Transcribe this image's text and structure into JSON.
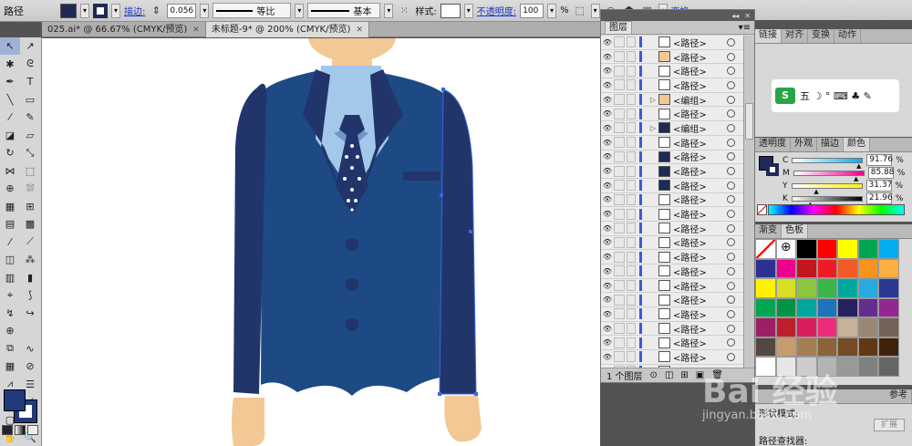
{
  "control_bar": {
    "object_type": "路径",
    "stroke_link": "描边:",
    "stroke_weight": "0.056",
    "profile_label": "等比",
    "brush_label": "基本",
    "style_label": "样式:",
    "opacity_link": "不透明度:",
    "opacity_value": "100",
    "opacity_unit": "%",
    "transform_link": "变换",
    "fill_color": "#1e2a55"
  },
  "doc_tabs": [
    {
      "label": "025.ai* @ 66.67% (CMYK/预览)"
    },
    {
      "label": "未标题-9* @ 200% (CMYK/预览)"
    }
  ],
  "layers_panel": {
    "title": "图层",
    "rows": [
      {
        "name": "<路径>",
        "thumb": "#ffffff"
      },
      {
        "name": "<路径>",
        "thumb": "#f2c894"
      },
      {
        "name": "<路径>",
        "thumb": "#ffffff"
      },
      {
        "name": "<路径>",
        "thumb": "#ffffff"
      },
      {
        "name": "<编组>",
        "thumb": "#f2c894"
      },
      {
        "name": "<路径>",
        "thumb": "#ffffff"
      },
      {
        "name": "<编组>",
        "thumb": "#1e2a55"
      },
      {
        "name": "<路径>",
        "thumb": "#ffffff"
      },
      {
        "name": "<路径>",
        "thumb": "#1e2a55"
      },
      {
        "name": "<路径>",
        "thumb": "#1e2a55"
      },
      {
        "name": "<路径>",
        "thumb": "#1e2a55"
      },
      {
        "name": "<路径>",
        "thumb": "#ffffff"
      },
      {
        "name": "<路径>",
        "thumb": "#ffffff"
      },
      {
        "name": "<路径>",
        "thumb": "#ffffff"
      },
      {
        "name": "<路径>",
        "thumb": "#ffffff"
      },
      {
        "name": "<路径>",
        "thumb": "#ffffff"
      },
      {
        "name": "<路径>",
        "thumb": "#ffffff"
      },
      {
        "name": "<路径>",
        "thumb": "#ffffff"
      },
      {
        "name": "<路径>",
        "thumb": "#ffffff"
      },
      {
        "name": "<路径>",
        "thumb": "#ffffff"
      },
      {
        "name": "<路径>",
        "thumb": "#ffffff"
      },
      {
        "name": "<路径>",
        "thumb": "#ffffff"
      },
      {
        "name": "<路径>",
        "thumb": "#ffffff"
      },
      {
        "name": "<路径>",
        "thumb": "#ffffff"
      }
    ],
    "footer_count": "1 个图层"
  },
  "right_panels": {
    "top_tabs": [
      "链接",
      "对齐",
      "变换",
      "动作"
    ],
    "ime_icons": "五 ☽ ° ⌨ ♣ ✎",
    "color_tabs": [
      "透明度",
      "外观",
      "描边",
      "颜色"
    ],
    "cmyk": [
      {
        "label": "C",
        "value": "91.76",
        "unit": "%",
        "pct": 91.76
      },
      {
        "label": "M",
        "value": "85.88",
        "unit": "%",
        "pct": 85.88
      },
      {
        "label": "Y",
        "value": "31.37",
        "unit": "%",
        "pct": 31.37
      },
      {
        "label": "K",
        "value": "21.96",
        "unit": "%",
        "pct": 21.96
      }
    ],
    "swatch_tabs": [
      "渐变",
      "色板"
    ],
    "swatches": [
      "#ffffff",
      "#ffffff",
      "#000000",
      "#ff0000",
      "#ffff00",
      "#00a651",
      "#00aeef",
      "#2e3192",
      "#ec008c",
      "#c4161c",
      "#ed1c24",
      "#f15a24",
      "#f7941d",
      "#fbb040",
      "#fff200",
      "#d7df23",
      "#8dc63f",
      "#39b54a",
      "#00a99d",
      "#27aae1",
      "#2b3990",
      "#00a651",
      "#009444",
      "#00a79d",
      "#1c75bc",
      "#262262",
      "#662d91",
      "#92278f",
      "#9e1f63",
      "#be1e2d",
      "#da1c5c",
      "#ed2a7b",
      "#c7b299",
      "#998675",
      "#736357",
      "#534741",
      "#c69c6d",
      "#a67c52",
      "#8c6239",
      "#754c24",
      "#603813",
      "#42210b",
      "#ffffff",
      "#e6e6e6",
      "#cccccc",
      "#b3b3b3",
      "#999999",
      "#808080",
      "#666666"
    ],
    "shape_mode_label": "形状模式:",
    "pathfinder_label": "路径查找器:",
    "expand_button": "扩展",
    "bottom_tabs_suffix": "参考"
  },
  "watermark": {
    "brand": "Bai 经验",
    "url": "jingyan.baidu.com"
  }
}
